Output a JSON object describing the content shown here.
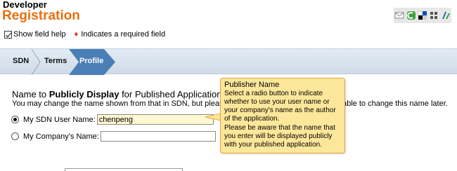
{
  "header": {
    "subtitle": "Developer",
    "title": "Registration",
    "accent_color": "#e8700f"
  },
  "share_icons": [
    "email-icon",
    "fuzz-icon",
    "delicious-icon",
    "digg-icon",
    "kaboodle-icon"
  ],
  "help": {
    "show_field_help_label": "Show field help",
    "show_field_help_checked": true,
    "required_indicator": "♦",
    "required_text": "Indicates a required field"
  },
  "nav": {
    "steps": [
      {
        "label": "SDN",
        "active": false
      },
      {
        "label": "Terms",
        "active": false
      },
      {
        "label": "Profile",
        "active": true
      }
    ]
  },
  "section": {
    "title_prefix": "Name to ",
    "title_bold": "Publicly Display",
    "title_suffix": " for Published Applications",
    "description_left": "You may change the name shown from that in SDN, but please not",
    "description_right": "able to change this name later."
  },
  "options": {
    "sdn_user_label": "My SDN User Name:",
    "sdn_user_value": "chenpeng",
    "sdn_user_selected": true,
    "company_label": "My Company's Name:",
    "company_value": "",
    "company_selected": false
  },
  "tooltip": {
    "title": "Publisher Name",
    "paragraph1": "Select a radio button to indicate whether to use your user name or your company's name as the author of the application.",
    "paragraph2": "Please be aware that the name that you enter will be displayed publicly with your published application."
  }
}
